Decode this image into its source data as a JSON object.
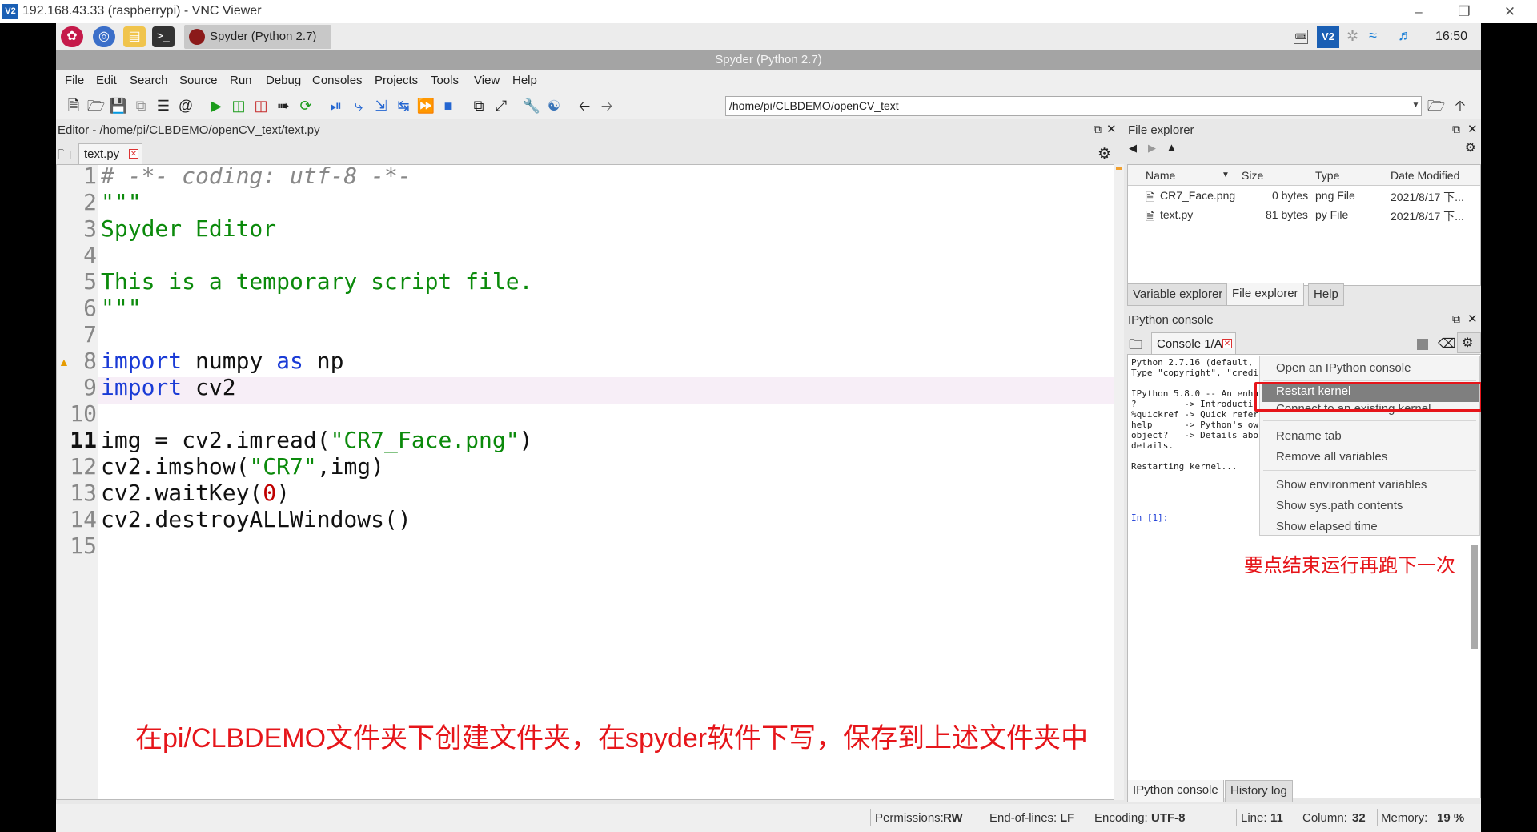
{
  "vnc": {
    "logo": "V2",
    "title": "192.168.43.33 (raspberrypi) - VNC Viewer"
  },
  "panel": {
    "task_label": "Spyder (Python 2.7)",
    "clock": "16:50"
  },
  "spyder": {
    "title": "Spyder (Python 2.7)"
  },
  "menu": [
    "File",
    "Edit",
    "Search",
    "Source",
    "Run",
    "Debug",
    "Consoles",
    "Projects",
    "Tools",
    "View",
    "Help"
  ],
  "toolbar": {
    "path": "/home/pi/CLBDEMO/openCV_text"
  },
  "editor": {
    "title": "Editor - /home/pi/CLBDEMO/openCV_text/text.py",
    "tab": "text.py",
    "lines": [
      "# -*- coding: utf-8 -*-",
      "\"\"\"",
      "Spyder Editor",
      "",
      "This is a temporary script file.",
      "\"\"\"",
      "",
      "import numpy as np",
      "import cv2",
      "",
      "img = cv2.imread(\"CR7_Face.png\")",
      "cv2.imshow(\"CR7\",img)",
      "cv2.waitKey(0)",
      "cv2.destroyALLWindows()",
      ""
    ],
    "annotation": "在pi/CLBDEMO文件夹下创建文件夹，在spyder软件下写，保存到上述文件夹中"
  },
  "file_explorer": {
    "title": "File explorer",
    "columns": [
      "Name",
      "Size",
      "Type",
      "Date Modified"
    ],
    "rows": [
      {
        "name": "CR7_Face.png",
        "size": "0 bytes",
        "type": "png File",
        "date": "2021/8/17 下..."
      },
      {
        "name": "text.py",
        "size": "81 bytes",
        "type": "py File",
        "date": "2021/8/17 下..."
      }
    ],
    "tabs": [
      "Variable explorer",
      "File explorer",
      "Help"
    ]
  },
  "ipython": {
    "title": "IPython console",
    "tab": "Console 1/A",
    "lines": [
      "Python 2.7.16 (default,",
      "Type \"copyright\", \"credi",
      "",
      "IPython 5.8.0 -- An enha",
      "?         -> Introducti",
      "%quickref -> Quick refer",
      "help      -> Python's ow",
      "object?   -> Details abo",
      "details.",
      "",
      "Restarting kernel...",
      "",
      "",
      "",
      "",
      "In [1]:"
    ],
    "bottom_tabs": [
      "IPython console",
      "History log"
    ],
    "annotation": "要点结束运行再跑下一次"
  },
  "context_menu": {
    "items": [
      "Open an IPython console",
      "Restart kernel",
      "Connect to an existing kernel",
      "Rename tab",
      "Remove all variables",
      "Show environment variables",
      "Show sys.path contents",
      "Show elapsed time"
    ]
  },
  "status": {
    "permissions_label": "Permissions:",
    "permissions": "RW",
    "eol_label": "End-of-lines:",
    "eol": "LF",
    "encoding_label": "Encoding:",
    "encoding": "UTF-8",
    "line_label": "Line:",
    "line": "11",
    "column_label": "Column:",
    "column": "32",
    "memory_label": "Memory:",
    "memory": "19 %"
  }
}
